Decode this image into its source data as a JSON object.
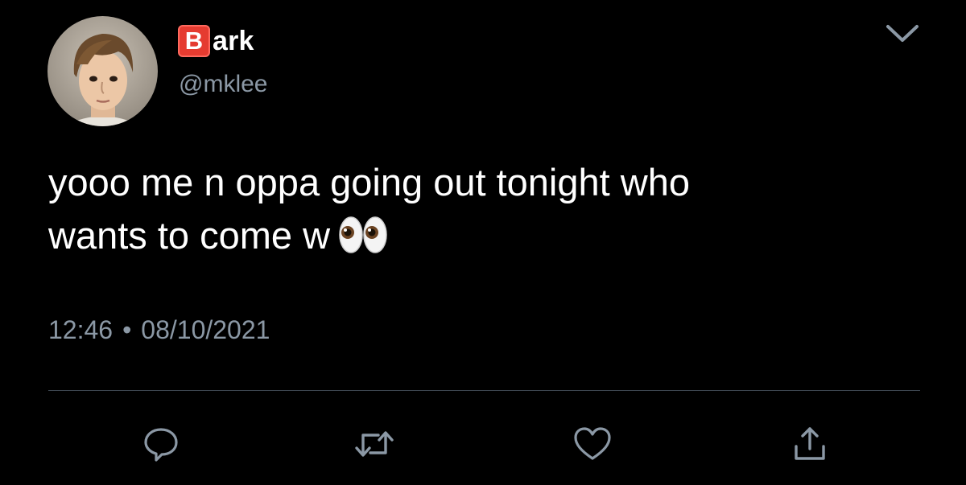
{
  "tweet": {
    "author": {
      "name_badge_letter": "B",
      "name_rest": "ark",
      "handle": "@mklee",
      "avatar_icon": "profile-photo"
    },
    "menu_icon": "chevron-down-icon",
    "text_line1": "yooo me n oppa going out tonight who",
    "text_line2": "wants to come w",
    "emoji": "eyes",
    "time": "12:46",
    "separator": "•",
    "date": "08/10/2021",
    "actions": [
      {
        "name": "reply",
        "icon": "speech-bubble-icon"
      },
      {
        "name": "retweet",
        "icon": "retweet-icon"
      },
      {
        "name": "like",
        "icon": "heart-icon"
      },
      {
        "name": "share",
        "icon": "share-icon"
      }
    ]
  },
  "colors": {
    "background": "#000000",
    "text": "#ffffff",
    "secondary_text": "#8b98a5",
    "badge": "#e53b30",
    "divider": "#3d4650"
  }
}
